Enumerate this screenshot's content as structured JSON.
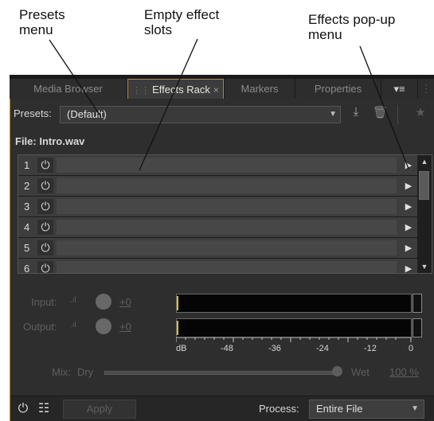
{
  "callouts": {
    "presets_line1": "Presets",
    "presets_line2": "menu",
    "slots_line1": "Empty effect",
    "slots_line2": "slots",
    "popup_line1": "Effects pop-up",
    "popup_line2": "menu"
  },
  "tabs": [
    {
      "label": "Media Browser",
      "active": false
    },
    {
      "label": "Effects Rack",
      "active": true
    },
    {
      "label": "Markers",
      "active": false
    },
    {
      "label": "Properties",
      "active": false
    }
  ],
  "presets": {
    "label": "Presets:",
    "value": "(Default)"
  },
  "file": {
    "label": "File: Intro.wav"
  },
  "slots": [
    {
      "number": "1"
    },
    {
      "number": "2"
    },
    {
      "number": "3"
    },
    {
      "number": "4"
    },
    {
      "number": "5"
    },
    {
      "number": "6"
    }
  ],
  "input": {
    "label": "Input:",
    "value": "+0"
  },
  "output": {
    "label": "Output:",
    "value": "+0"
  },
  "scale": [
    "dB",
    "-48",
    "-36",
    "-24",
    "-12",
    "0"
  ],
  "mix": {
    "label": "Mix:",
    "dry": "Dry",
    "wet": "Wet",
    "value": "100 %",
    "level": 1.0
  },
  "bottom": {
    "apply": "Apply",
    "process_label": "Process:",
    "process_value": "Entire File"
  },
  "colors": {
    "accent": "#c5881b",
    "meter_peak": "#e0c41a",
    "panel": "#2e2e2e"
  }
}
